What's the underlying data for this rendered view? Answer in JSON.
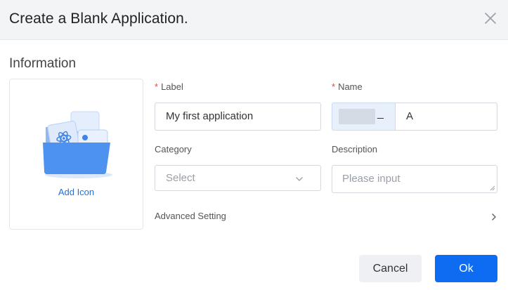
{
  "dialog": {
    "title": "Create a Blank Application."
  },
  "section": {
    "title": "Information"
  },
  "icon_box": {
    "add_label": "Add Icon"
  },
  "fields": {
    "label": {
      "label": "Label",
      "value": "My first application"
    },
    "name": {
      "label": "Name",
      "prefix_suffix": "_",
      "value": "A"
    },
    "category": {
      "label": "Category",
      "placeholder": "Select"
    },
    "description": {
      "label": "Description",
      "placeholder": "Please input"
    }
  },
  "advanced": {
    "label": "Advanced Setting"
  },
  "buttons": {
    "cancel": "Cancel",
    "ok": "Ok"
  },
  "colors": {
    "accent": "#0d6cf2",
    "required": "#e0483b",
    "link": "#1f73d8"
  }
}
